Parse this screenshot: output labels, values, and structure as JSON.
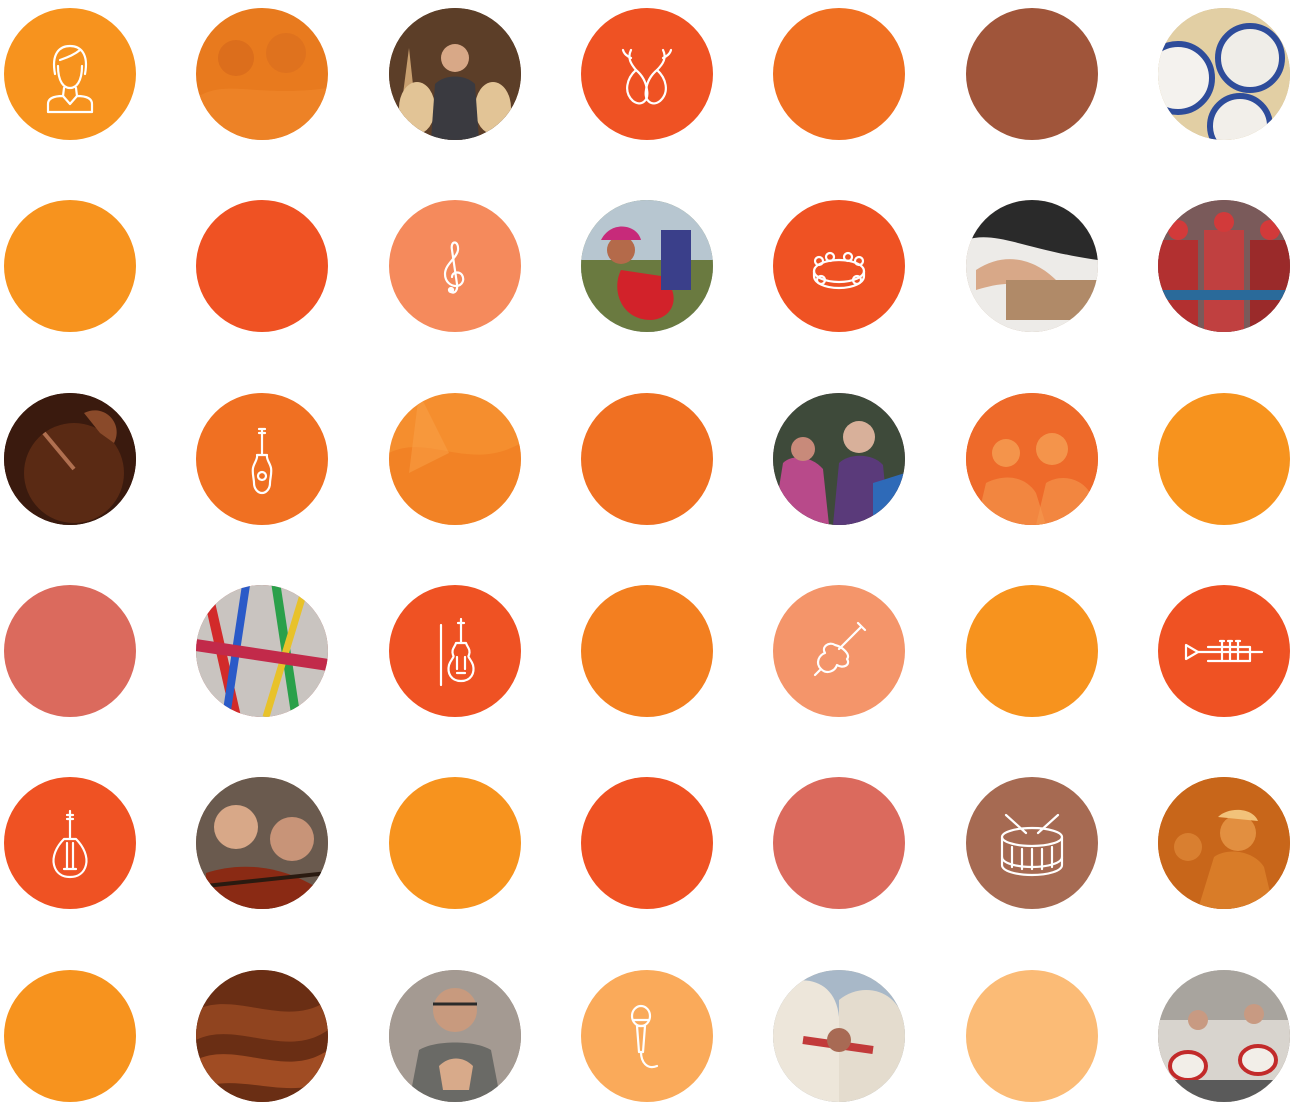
{
  "grid": {
    "tiles": [
      {
        "kind": "icon",
        "icon": "woman-avatar-icon",
        "color": "#F7931E"
      },
      {
        "kind": "photo",
        "photo": "orange-duotone-crowd-photo",
        "color": "#E87A1E"
      },
      {
        "kind": "photo",
        "photo": "luthier-with-guitars-photo",
        "color": "#6B4A2E"
      },
      {
        "kind": "icon",
        "icon": "castanets-icon",
        "color": "#EF5223"
      },
      {
        "kind": "solid",
        "color": "#F07022"
      },
      {
        "kind": "solid",
        "color": "#A0553A"
      },
      {
        "kind": "photo",
        "photo": "drums-from-above-photo",
        "color": "#C9B28A"
      },
      {
        "kind": "solid",
        "color": "#F7931E"
      },
      {
        "kind": "solid",
        "color": "#EF5223"
      },
      {
        "kind": "icon",
        "icon": "treble-clef-icon",
        "color": "#F58A5C"
      },
      {
        "kind": "photo",
        "photo": "child-with-red-guitar-photo",
        "color": "#7E8A56"
      },
      {
        "kind": "icon",
        "icon": "tambourine-icon",
        "color": "#EF5223"
      },
      {
        "kind": "photo",
        "photo": "craftsman-hands-photo",
        "color": "#B89A7E"
      },
      {
        "kind": "photo",
        "photo": "costumed-parade-photo",
        "color": "#8E3B3B"
      },
      {
        "kind": "photo",
        "photo": "dark-drum-photo",
        "color": "#4A2212"
      },
      {
        "kind": "icon",
        "icon": "guitar-icon",
        "color": "#F07022"
      },
      {
        "kind": "photo",
        "photo": "orange-duotone-photo",
        "color": "#F58E2E"
      },
      {
        "kind": "solid",
        "color": "#F07022"
      },
      {
        "kind": "photo",
        "photo": "festival-women-photo",
        "color": "#7A4A6A"
      },
      {
        "kind": "photo",
        "photo": "orange-duotone-singers-photo",
        "color": "#EF6A2A"
      },
      {
        "kind": "solid",
        "color": "#F7931E"
      },
      {
        "kind": "solid",
        "color": "#DB6A5D"
      },
      {
        "kind": "photo",
        "photo": "colorful-ribbons-photo",
        "color": "#B8524A"
      },
      {
        "kind": "icon",
        "icon": "violin-icon",
        "color": "#EF5223"
      },
      {
        "kind": "solid",
        "color": "#F37F20"
      },
      {
        "kind": "icon",
        "icon": "cello-icon",
        "color": "#F4956A"
      },
      {
        "kind": "solid",
        "color": "#F7931E"
      },
      {
        "kind": "icon",
        "icon": "trumpet-icon",
        "color": "#EF5223"
      },
      {
        "kind": "icon",
        "icon": "mandolin-icon",
        "color": "#EF5223"
      },
      {
        "kind": "photo",
        "photo": "violinists-photo",
        "color": "#9A6A4E"
      },
      {
        "kind": "solid",
        "color": "#F7931E"
      },
      {
        "kind": "solid",
        "color": "#EF5223"
      },
      {
        "kind": "solid",
        "color": "#DB6A5D"
      },
      {
        "kind": "icon",
        "icon": "drum-icon",
        "color": "#A66A52"
      },
      {
        "kind": "photo",
        "photo": "orange-duotone-band-photo",
        "color": "#D0701E"
      },
      {
        "kind": "solid",
        "color": "#F7931E"
      },
      {
        "kind": "photo",
        "photo": "brown-wood-swirl-photo",
        "color": "#7A3A1C"
      },
      {
        "kind": "photo",
        "photo": "carver-at-work-photo",
        "color": "#8E7A68"
      },
      {
        "kind": "icon",
        "icon": "microphone-icon",
        "color": "#FAAA5A"
      },
      {
        "kind": "photo",
        "photo": "veiled-women-photo",
        "color": "#C8B8A0"
      },
      {
        "kind": "solid",
        "color": "#FBBB76"
      },
      {
        "kind": "photo",
        "photo": "street-drummers-photo",
        "color": "#7E6A5C"
      }
    ]
  }
}
